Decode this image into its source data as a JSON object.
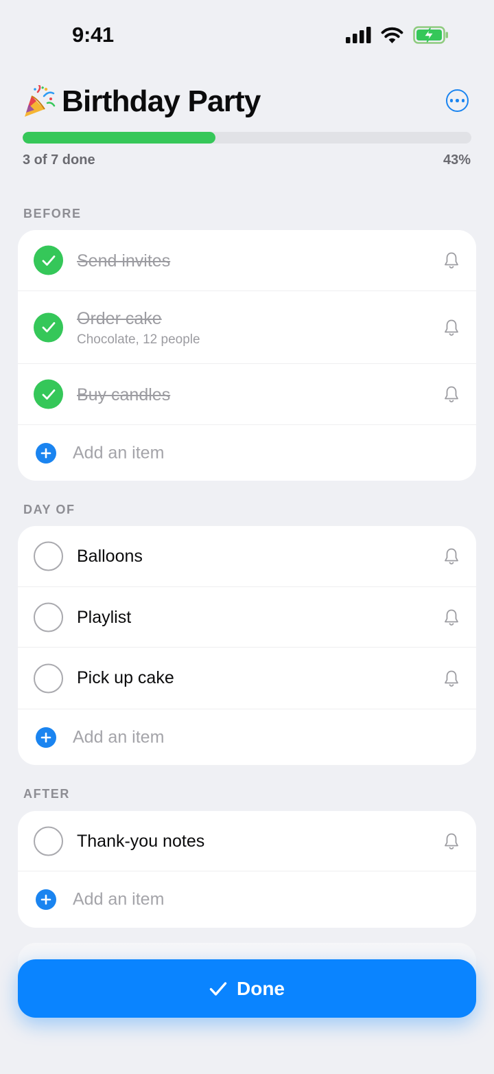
{
  "status_bar": {
    "time": "9:41"
  },
  "header": {
    "title": "Birthday Party",
    "progress_label": "3 of 7 done",
    "progress_percent_label": "43%",
    "progress_fraction": 0.43
  },
  "sections": [
    {
      "title": "BEFORE",
      "items": [
        {
          "title": "Send invites",
          "done": true
        },
        {
          "title": "Order cake",
          "subtitle": "Chocolate, 12 people",
          "done": true
        },
        {
          "title": "Buy candles",
          "done": true
        }
      ],
      "add_label": "Add an item"
    },
    {
      "title": "DAY OF",
      "items": [
        {
          "title": "Balloons",
          "done": false
        },
        {
          "title": "Playlist",
          "done": false
        },
        {
          "title": "Pick up cake",
          "done": false
        }
      ],
      "add_label": "Add an item"
    },
    {
      "title": "AFTER",
      "items": [
        {
          "title": "Thank-you notes",
          "done": false
        }
      ],
      "add_label": "Add an item"
    }
  ],
  "footer": {
    "done_label": "Done"
  },
  "colors": {
    "accent": "#0A84FF",
    "success": "#35C759",
    "background": "#EFF0F4"
  },
  "icons": [
    "party-popper-icon",
    "more-icon",
    "bell-icon",
    "checkmark-icon",
    "plus-icon",
    "signal-icon",
    "wifi-icon",
    "battery-charging-icon"
  ]
}
